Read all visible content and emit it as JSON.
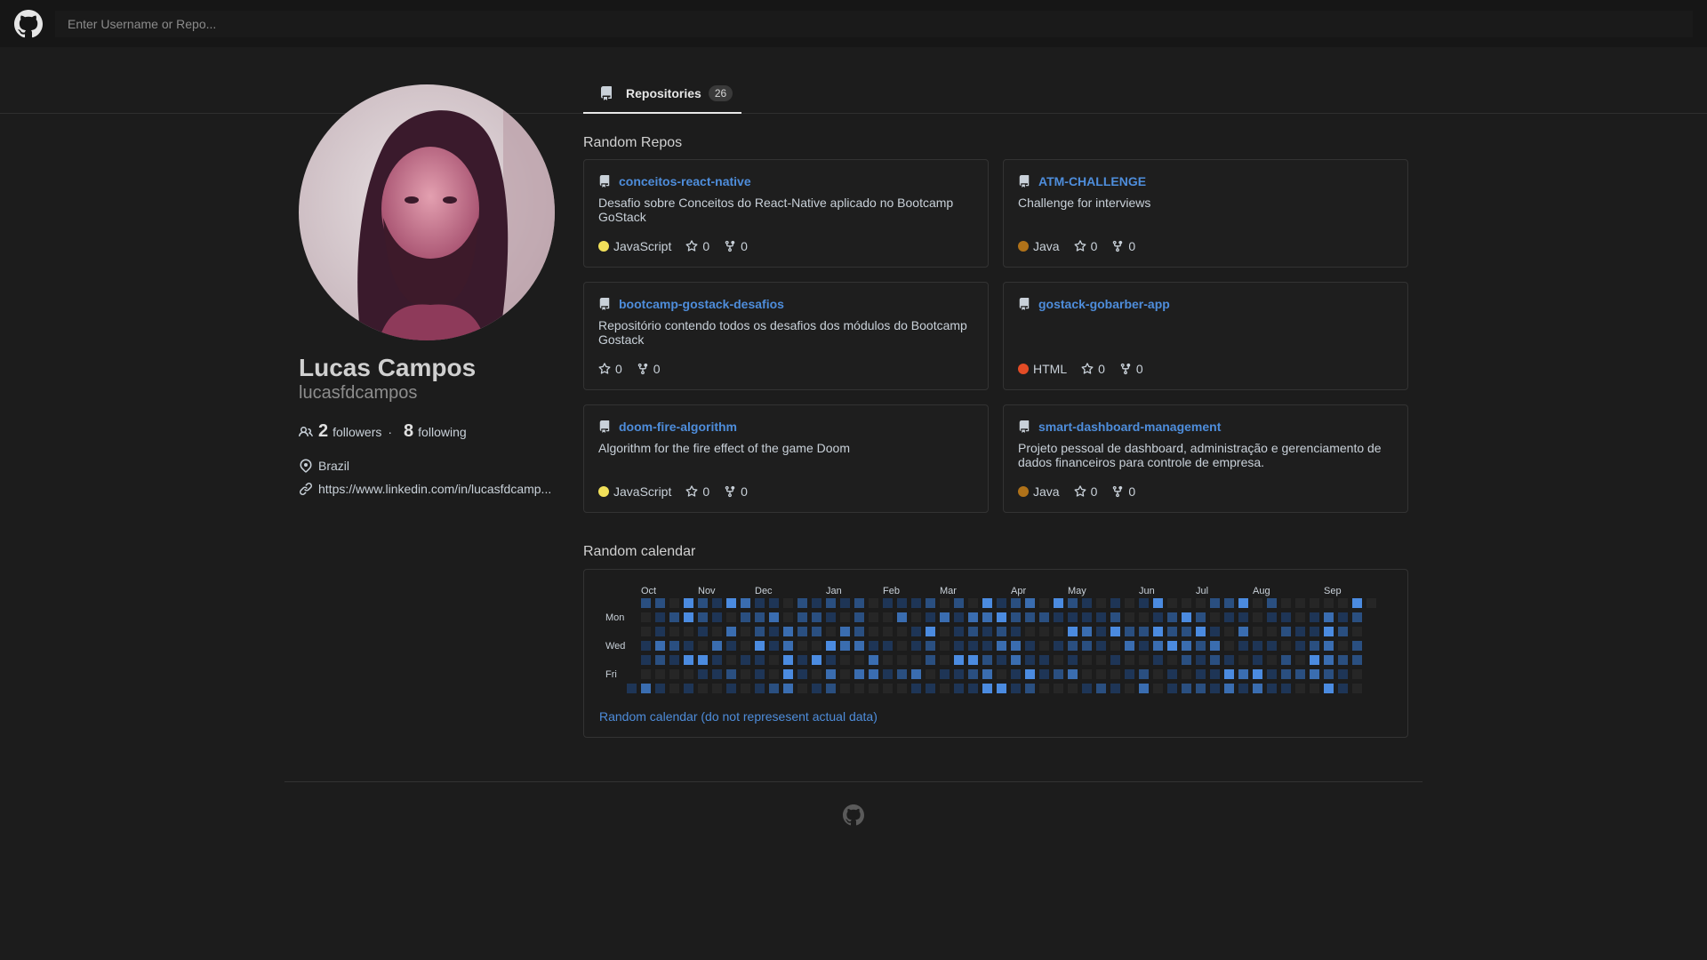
{
  "header": {
    "logo_icon": "github-logo-icon",
    "search_placeholder": "Enter Username or Repo..."
  },
  "tabs": [
    {
      "label": "Repositories",
      "count": "26",
      "icon": "repo-icon"
    }
  ],
  "profile": {
    "name": "Lucas Campos",
    "login": "lucasfdcampos",
    "followers_count": "2",
    "followers_label": "followers",
    "separator": "·",
    "following_count": "8",
    "following_label": "following",
    "location": "Brazil",
    "website": "https://www.linkedin.com/in/lucasfdcamp..."
  },
  "random_repos": {
    "title": "Random Repos",
    "repos": [
      {
        "name": "conceitos-react-native",
        "description": "Desafio sobre Conceitos do React-Native aplicado no Bootcamp GoStack",
        "language": "JavaScript",
        "language_color": "#f1e05a",
        "stars": "0",
        "forks": "0"
      },
      {
        "name": "ATM-CHALLENGE",
        "description": "Challenge for interviews",
        "language": "Java",
        "language_color": "#b07219",
        "stars": "0",
        "forks": "0"
      },
      {
        "name": "bootcamp-gostack-desafios",
        "description": "Repositório contendo todos os desafios dos módulos do Bootcamp Gostack",
        "language": "",
        "language_color": "",
        "stars": "0",
        "forks": "0"
      },
      {
        "name": "gostack-gobarber-app",
        "description": "",
        "language": "HTML",
        "language_color": "#e34c26",
        "stars": "0",
        "forks": "0"
      },
      {
        "name": "doom-fire-algorithm",
        "description": "Algorithm for the fire effect of the game Doom",
        "language": "JavaScript",
        "language_color": "#f1e05a",
        "stars": "0",
        "forks": "0"
      },
      {
        "name": "smart-dashboard-management",
        "description": "Projeto pessoal de dashboard, administração e gerenciamento de dados financeiros para controle de empresa.",
        "language": "Java",
        "language_color": "#b07219",
        "stars": "0",
        "forks": "0"
      }
    ]
  },
  "calendar": {
    "title": "Random calendar",
    "months": [
      "Oct",
      "Nov",
      "Dec",
      "Jan",
      "Feb",
      "Mar",
      "Apr",
      "May",
      "Jun",
      "Jul",
      "Aug",
      "Sep"
    ],
    "day_labels": [
      "Mon",
      "Wed",
      "Fri"
    ],
    "link_text": "Random calendar (do not represesent actual data)",
    "colors": [
      "#262626",
      "#1e3556",
      "#2a4f80",
      "#3a6db0",
      "#4b8be0"
    ]
  },
  "footer": {
    "logo_icon": "github-logo-icon"
  }
}
